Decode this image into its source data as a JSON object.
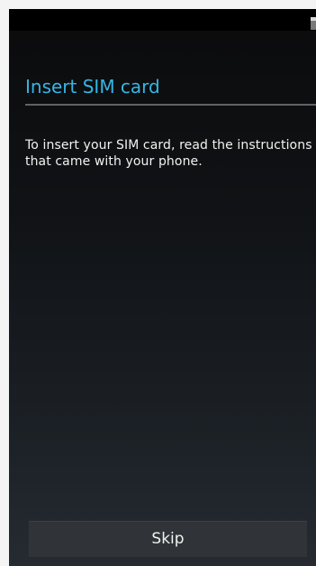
{
  "screen": {
    "title": "Insert SIM card",
    "instructions": "To insert your SIM card, read the instructions that came with your phone.",
    "skip_label": "Skip"
  },
  "icons": {
    "status": "battery-icon"
  },
  "colors": {
    "accent": "#35b6e5",
    "background_top": "#0b0b0c",
    "background_bottom": "#252b31",
    "button_background": "#303438",
    "text": "#f2f2f2"
  }
}
